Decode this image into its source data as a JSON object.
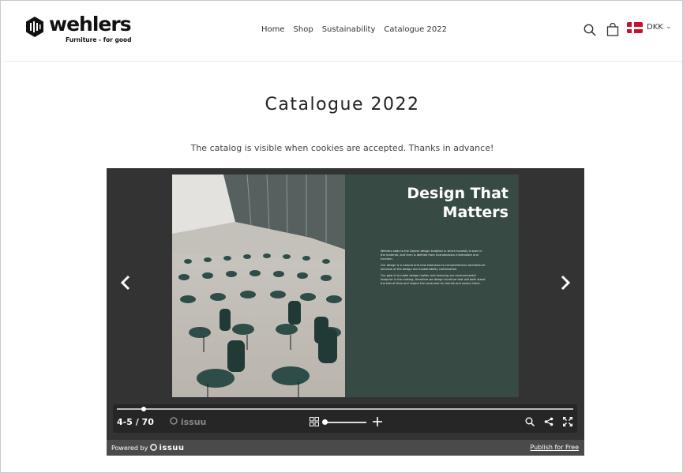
{
  "header": {
    "logo_word": "wehlers",
    "logo_tagline": "Furniture - for good",
    "nav": [
      "Home",
      "Shop",
      "Sustainability",
      "Catalogue 2022"
    ],
    "currency": "DKK",
    "icons": [
      "search-icon",
      "bag-icon",
      "denmark-flag-icon",
      "chevron-down-icon"
    ]
  },
  "main": {
    "title": "Catalogue 2022",
    "notice": "The catalog is visible when cookies are accepted. Thanks in advance!"
  },
  "viewer": {
    "spread_title_line1": "Design That",
    "spread_title_line2": "Matters",
    "spread_paragraphs": [
      "Wehlers adds to the Danish design tradition in which honesty is seen in the material, and form is defined from Scandinavian minimalism and function.",
      "Our design is a natural and new extension to comprehensive architecture because of the design and sustainability combination.",
      "Our goal is to make design matter and reducing our environmental footprint in the making, therefore we design furniture that will both stand the test of time and inspire the consumer to cherish and savour them."
    ],
    "page_indicator": "4-5 / 70",
    "brand": "issuu",
    "powered_by": "Powered by",
    "publish_link": "Publish for Free",
    "colors": {
      "viewer_bg": "#333333",
      "page_green": "#384a44"
    }
  }
}
